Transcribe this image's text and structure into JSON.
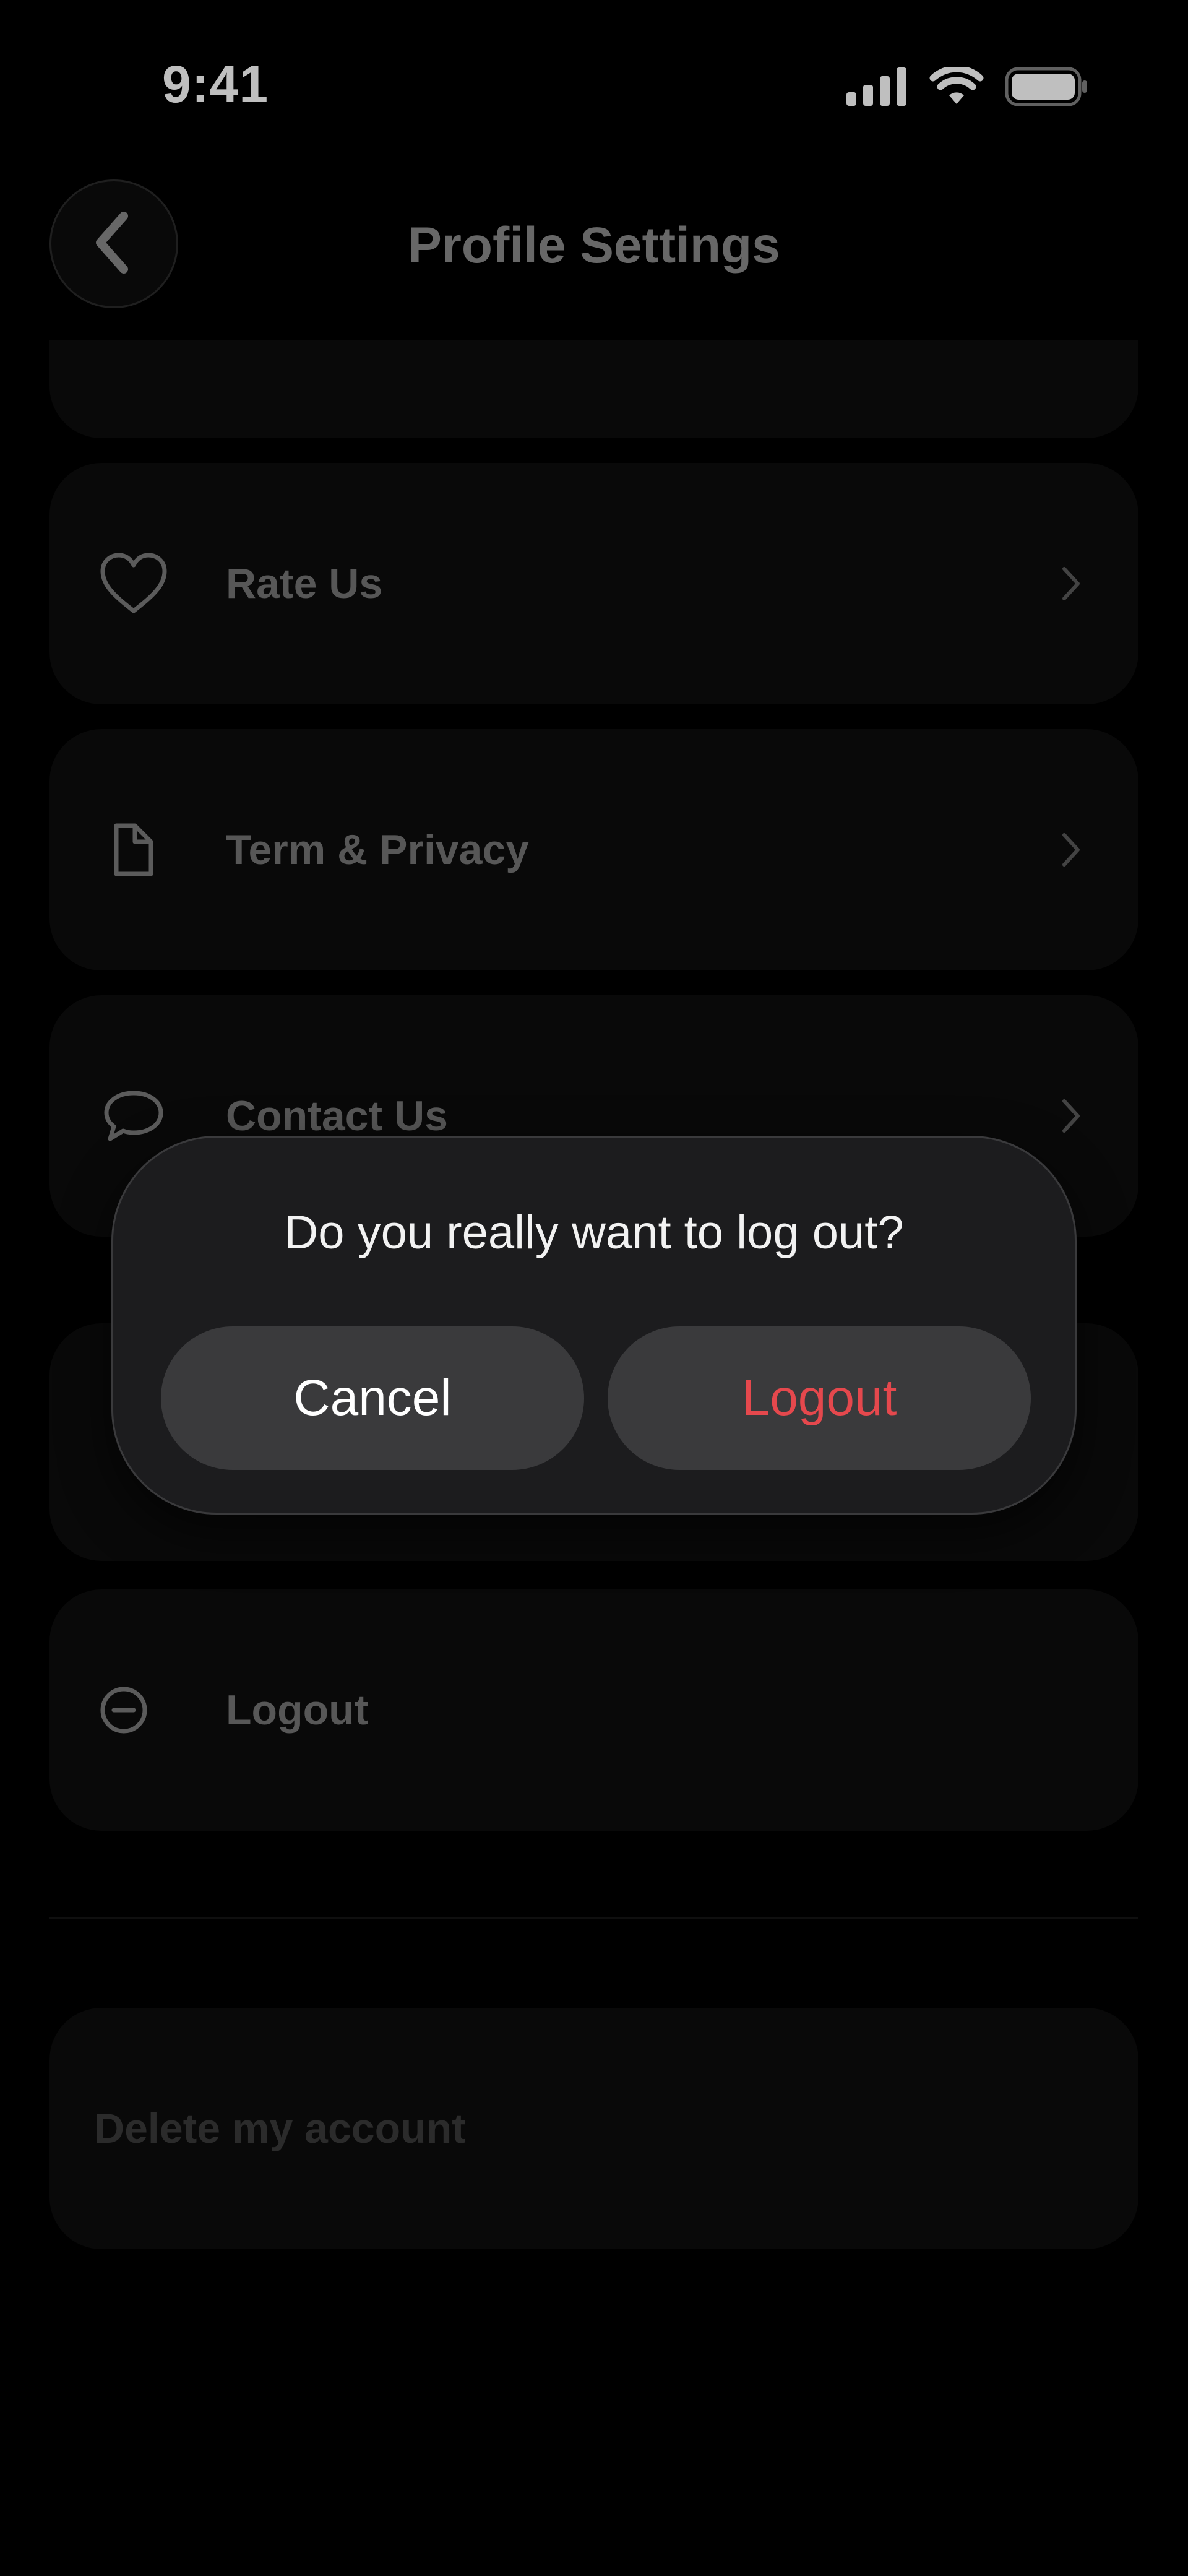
{
  "status_bar": {
    "time": "9:41",
    "icons": [
      "signal-icon",
      "wifi-icon",
      "battery-icon"
    ]
  },
  "header": {
    "title": "Profile Settings",
    "back_icon": "chevron-left-icon"
  },
  "menu": {
    "items": [
      {
        "label": "Rate Us",
        "icon": "heart-icon"
      },
      {
        "label": "Term & Privacy",
        "icon": "document-icon"
      },
      {
        "label": "Contact Us",
        "icon": "chat-bubble-icon"
      },
      {
        "label": "Logout",
        "icon": "minus-circle-icon"
      }
    ]
  },
  "danger_zone": {
    "delete_label": "Delete my account"
  },
  "dialog": {
    "message": "Do you really want to log out?",
    "cancel_label": "Cancel",
    "confirm_label": "Logout"
  },
  "colors": {
    "background": "#000000",
    "card": "#0c0c0c",
    "dialog": "#1c1c1e",
    "button": "#3a3a3c",
    "destructive": "#e5484d"
  }
}
